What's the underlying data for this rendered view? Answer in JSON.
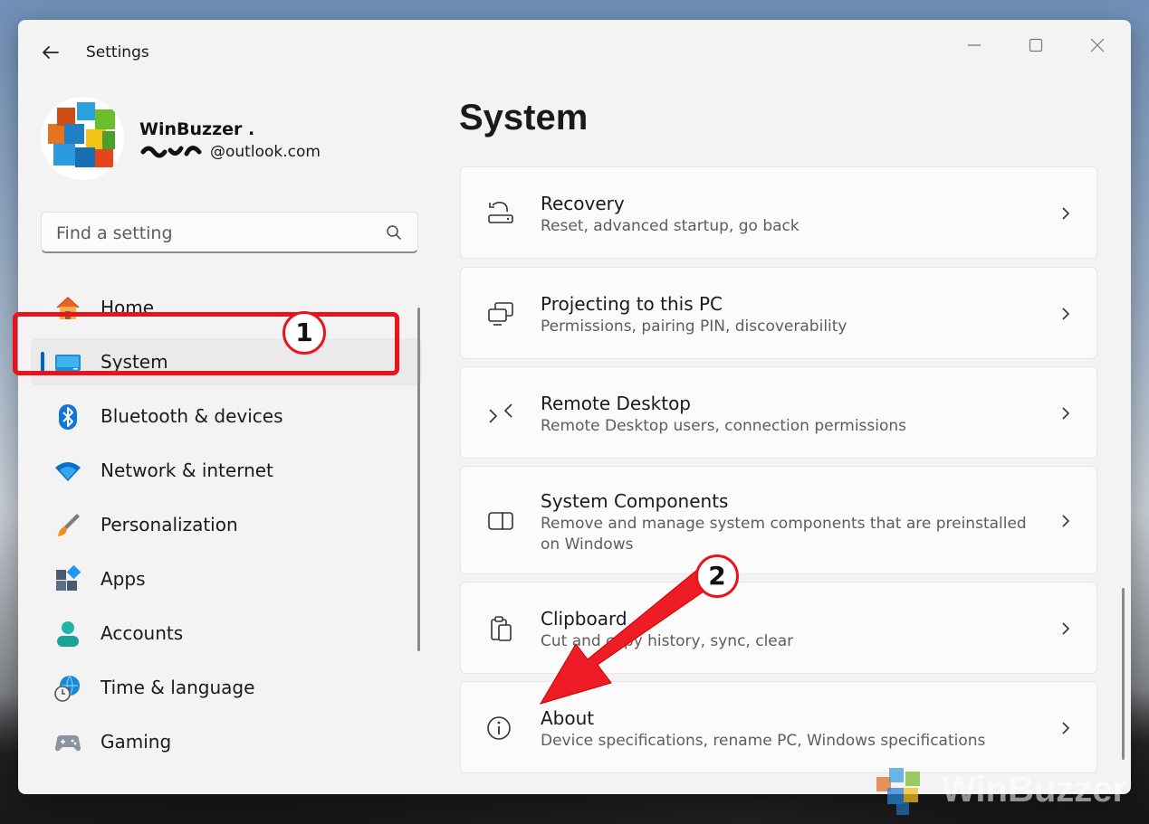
{
  "window": {
    "title": "Settings"
  },
  "profile": {
    "name": "WinBuzzer .",
    "email": "@outlook.com"
  },
  "search": {
    "placeholder": "Find a setting"
  },
  "nav": {
    "items": [
      {
        "label": "Home",
        "icon": "home-icon"
      },
      {
        "label": "System",
        "icon": "system-display-icon",
        "selected": true
      },
      {
        "label": "Bluetooth & devices",
        "icon": "bluetooth-icon"
      },
      {
        "label": "Network & internet",
        "icon": "wifi-icon"
      },
      {
        "label": "Personalization",
        "icon": "brush-icon"
      },
      {
        "label": "Apps",
        "icon": "apps-icon"
      },
      {
        "label": "Accounts",
        "icon": "person-icon"
      },
      {
        "label": "Time & language",
        "icon": "globe-clock-icon"
      },
      {
        "label": "Gaming",
        "icon": "gamepad-icon"
      }
    ]
  },
  "main": {
    "title": "System",
    "cards": [
      {
        "title": "Recovery",
        "desc": "Reset, advanced startup, go back",
        "icon": "recovery-icon"
      },
      {
        "title": "Projecting to this PC",
        "desc": "Permissions, pairing PIN, discoverability",
        "icon": "projecting-icon"
      },
      {
        "title": "Remote Desktop",
        "desc": "Remote Desktop users, connection permissions",
        "icon": "remote-desktop-icon"
      },
      {
        "title": "System Components",
        "desc": "Remove and manage system components that are preinstalled on Windows",
        "icon": "system-components-icon"
      },
      {
        "title": "Clipboard",
        "desc": "Cut and copy history, sync, clear",
        "icon": "clipboard-icon"
      },
      {
        "title": "About",
        "desc": "Device specifications, rename PC, Windows specifications",
        "icon": "info-icon"
      }
    ]
  },
  "annotations": {
    "step1": "1",
    "step2": "2",
    "highlight_color": "#e8131c"
  },
  "watermark": {
    "text": "WinBuzzer"
  },
  "colors": {
    "accent": "#0067c0",
    "window_bg": "#f3f3f3",
    "card_bg": "#fbfbfb"
  }
}
